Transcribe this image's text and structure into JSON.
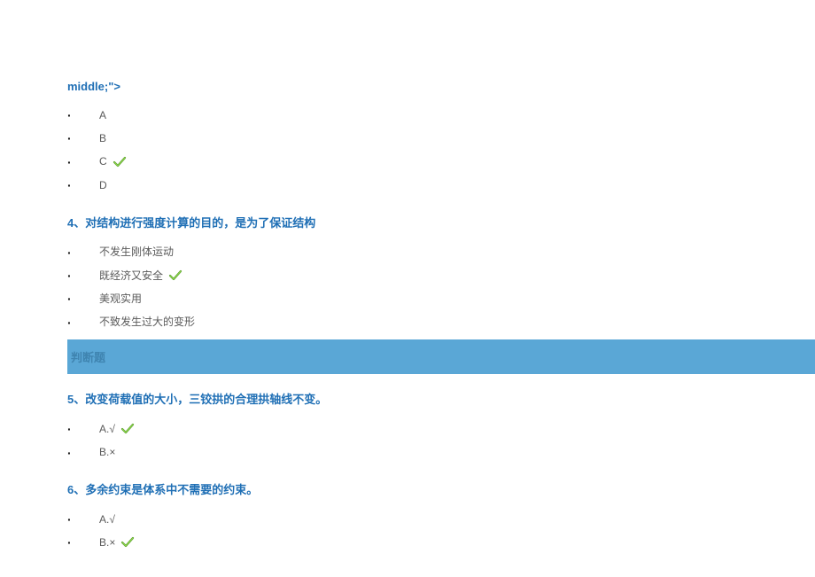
{
  "header": {
    "fragment": "middle;\">"
  },
  "q3": {
    "options": [
      "A",
      "B",
      "C",
      "D"
    ],
    "correct_index": 2
  },
  "q4": {
    "title": "4、对结构进行强度计算的目的，是为了保证结构",
    "options": [
      "不发生刚体运动",
      "既经济又安全",
      "美观实用",
      "不致发生过大的变形"
    ],
    "correct_index": 1
  },
  "section_header": "判断题",
  "q5": {
    "title": "5、改变荷载值的大小，三铰拱的合理拱轴线不变。",
    "options": [
      "A.√",
      "B.×"
    ],
    "correct_index": 0
  },
  "q6": {
    "title": "6、多余约束是体系中不需要的约束。",
    "options": [
      "A.√",
      "B.×"
    ],
    "correct_index": 1
  },
  "icons": {
    "check_color": "#71c837",
    "check_stroke": "#4d8f26"
  }
}
